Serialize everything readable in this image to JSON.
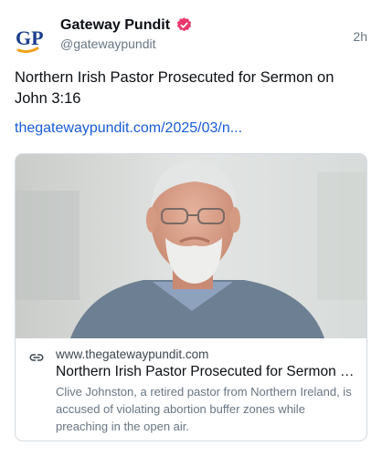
{
  "post": {
    "author": {
      "display_name": "Gateway Pundit",
      "handle": "@gatewaypundit",
      "avatar_text": "GP"
    },
    "timestamp": "2h",
    "text": "Northern Irish Pastor Prosecuted for Sermon on John 3:16",
    "link_text": "thegatewaypundit.com/2025/03/n...",
    "card": {
      "domain": "www.thegatewaypundit.com",
      "title": "Northern Irish Pastor Prosecuted for Sermon o...",
      "description": "Clive Johnston, a retired pastor from Northern Ireland, is accused of violating abortion buffer zones while preaching in the open air."
    }
  },
  "colors": {
    "link": "#1a5bd8",
    "verified_badge": "#e8396a",
    "avatar_blue": "#1a3f8f",
    "avatar_orange": "#f0a21b"
  },
  "icons": {
    "verified": "verified-badge-icon",
    "link": "link-icon"
  }
}
